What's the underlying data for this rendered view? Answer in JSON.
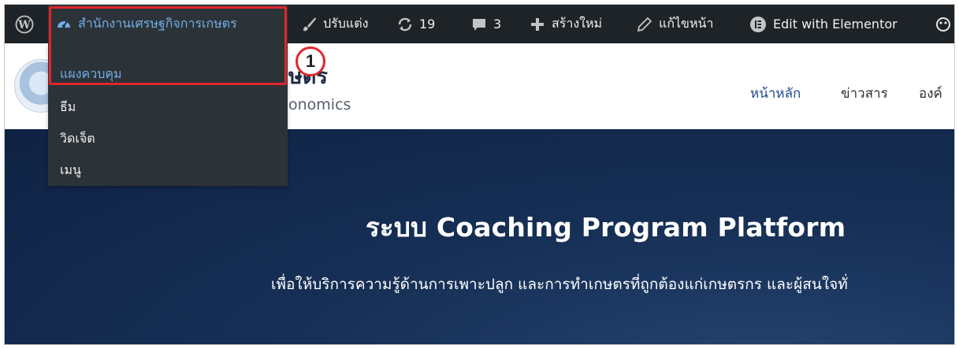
{
  "admin_bar": {
    "wp_logo_icon": "wordpress-icon",
    "site_name": "สำนักงานเศรษฐกิจการเกษตร",
    "customize_label": "ปรับแต่ง",
    "updates_count": "19",
    "comments_count": "3",
    "new_label": "สร้างใหม่",
    "edit_page_label": "แก้ไขหน้า",
    "elementor_label": "Edit with Elementor"
  },
  "site_menu": {
    "items": [
      "แผงควบคุม",
      "ธีม",
      "วิดเจ็ต",
      "เมนู"
    ]
  },
  "annotation": {
    "step": "1",
    "color": "#e0262b"
  },
  "header": {
    "title_visible": "ษตร",
    "subtitle_visible": "onomics",
    "nav": [
      "หน้าหลัก",
      "ข่าวสาร",
      "องค์"
    ]
  },
  "hero": {
    "title": "ระบบ Coaching Program Platform",
    "subtitle": "เพื่อให้บริการความรู้ด้านการเพาะปลูก และการทำเกษตรที่ถูกต้องแก่เกษตรกร และผู้สนใจทั่"
  },
  "colors": {
    "admin_bar_bg": "#1d2327",
    "submenu_bg": "#2c3338",
    "link_blue": "#72aee6",
    "hero_bg": "#162f55"
  }
}
